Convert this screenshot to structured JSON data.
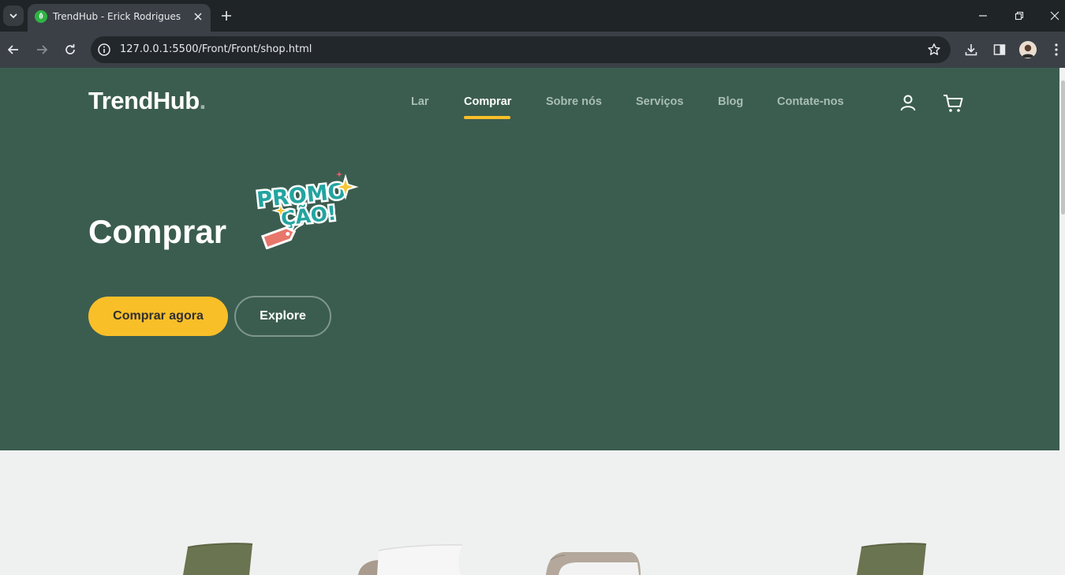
{
  "browser": {
    "tab_title": "TrendHub - Erick Rodrigues",
    "url": "127.0.0.1:5500/Front/Front/shop.html"
  },
  "site": {
    "logo_text": "TrendHub",
    "logo_dot": ".",
    "menu": [
      {
        "label": "Lar"
      },
      {
        "label": "Comprar"
      },
      {
        "label": "Sobre nós"
      },
      {
        "label": "Serviços"
      },
      {
        "label": "Blog"
      },
      {
        "label": "Contate-nos"
      }
    ]
  },
  "hero": {
    "title": "Comprar",
    "primary_button": "Comprar agora",
    "secondary_button": "Explore",
    "promo_sticker_text": "PROMOÇÃO!"
  },
  "colors": {
    "hero_bg": "#3b5d50",
    "accent": "#f9bf29",
    "page_bg": "#eff1f0"
  }
}
